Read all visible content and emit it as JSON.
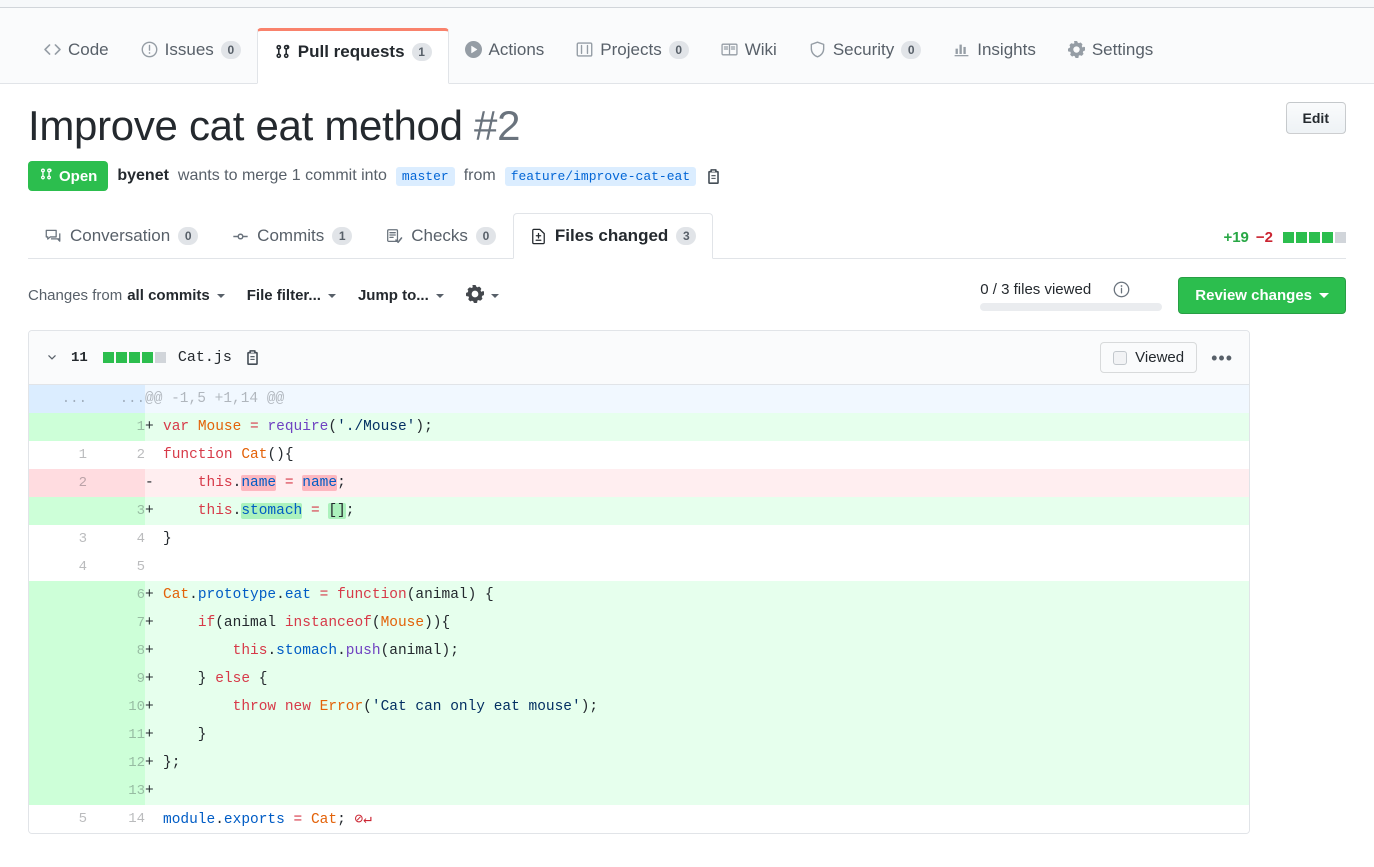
{
  "repo_nav": {
    "items": [
      {
        "label": "Code",
        "icon": "code-icon",
        "count": null,
        "selected": false
      },
      {
        "label": "Issues",
        "icon": "issue-icon",
        "count": "0",
        "selected": false
      },
      {
        "label": "Pull requests",
        "icon": "pull-request-icon",
        "count": "1",
        "selected": true
      },
      {
        "label": "Actions",
        "icon": "play-icon",
        "count": null,
        "selected": false
      },
      {
        "label": "Projects",
        "icon": "project-icon",
        "count": "0",
        "selected": false
      },
      {
        "label": "Wiki",
        "icon": "book-icon",
        "count": null,
        "selected": false
      },
      {
        "label": "Security",
        "icon": "shield-icon",
        "count": "0",
        "selected": false
      },
      {
        "label": "Insights",
        "icon": "graph-icon",
        "count": null,
        "selected": false
      },
      {
        "label": "Settings",
        "icon": "gear-icon",
        "count": null,
        "selected": false
      }
    ]
  },
  "pull_request": {
    "title": "Improve cat eat method",
    "number": "#2",
    "edit_label": "Edit",
    "state": "Open",
    "author": "byenet",
    "merge_text_1": "wants to merge 1 commit into",
    "base_branch": "master",
    "merge_text_2": "from",
    "head_branch": "feature/improve-cat-eat"
  },
  "pr_tabs": [
    {
      "label": "Conversation",
      "icon": "comment-discussion-icon",
      "count": "0",
      "selected": false
    },
    {
      "label": "Commits",
      "icon": "commit-icon",
      "count": "1",
      "selected": false
    },
    {
      "label": "Checks",
      "icon": "checklist-icon",
      "count": "0",
      "selected": false
    },
    {
      "label": "Files changed",
      "icon": "file-diff-icon",
      "count": "3",
      "selected": true
    }
  ],
  "diffstat": {
    "additions": "+19",
    "deletions": "−2",
    "blocks": [
      "g",
      "g",
      "g",
      "g",
      "n"
    ]
  },
  "toolbar": {
    "changes_from_prefix": "Changes from",
    "changes_from_value": "all commits",
    "file_filter_label": "File filter...",
    "jump_to_label": "Jump to...",
    "gear_icon": "gear-icon",
    "files_viewed": "0 / 3 files viewed",
    "info_icon": "info-icon",
    "review_changes_label": "Review changes"
  },
  "file": {
    "changes_count": "11",
    "blocks": [
      "g",
      "g",
      "g",
      "g",
      "n"
    ],
    "name": "Cat.js",
    "copy_icon": "copy-path-icon",
    "viewed_label": "Viewed",
    "kebab_icon": "kebab-horizontal-icon",
    "hunk_header": "@@ -1,5 +1,14 @@",
    "lines": [
      {
        "type": "hunk",
        "old": "...",
        "new": "...",
        "marker": "",
        "html": ""
      },
      {
        "type": "add",
        "old": "",
        "new": "1",
        "marker": "+",
        "html": "<span class=\"k\">var</span> <span class=\"e\">Mouse</span> <span class=\"k\">=</span> <span class=\"f\">require</span>(<span class=\"s\">'./Mouse'</span>);"
      },
      {
        "type": "ctx",
        "old": "1",
        "new": "2",
        "marker": "",
        "html": "<span class=\"k\">function</span> <span class=\"e\">Cat</span>(){"
      },
      {
        "type": "del",
        "old": "2",
        "new": "",
        "marker": "-",
        "html": "    <span class=\"k\">this</span>.<span class=\"wdel v\">name</span> <span class=\"k\">=</span> <span class=\"wdel v\">name</span>;"
      },
      {
        "type": "add",
        "old": "",
        "new": "3",
        "marker": "+",
        "html": "    <span class=\"k\">this</span>.<span class=\"wadd v\">stomach</span> <span class=\"k\">=</span> <span class=\"wadd p\">[]</span>;"
      },
      {
        "type": "ctx",
        "old": "3",
        "new": "4",
        "marker": "",
        "html": "}"
      },
      {
        "type": "ctx",
        "old": "4",
        "new": "5",
        "marker": "",
        "html": ""
      },
      {
        "type": "add",
        "old": "",
        "new": "6",
        "marker": "+",
        "html": "<span class=\"e\">Cat</span>.<span class=\"v\">prototype</span>.<span class=\"v\">eat</span> <span class=\"k\">=</span> <span class=\"k\">function</span>(animal) {"
      },
      {
        "type": "add",
        "old": "",
        "new": "7",
        "marker": "+",
        "html": "    <span class=\"k\">if</span>(animal <span class=\"k\">instanceof</span>(<span class=\"e\">Mouse</span>)){"
      },
      {
        "type": "add",
        "old": "",
        "new": "8",
        "marker": "+",
        "html": "        <span class=\"k\">this</span>.<span class=\"v\">stomach</span>.<span class=\"f\">push</span>(animal);"
      },
      {
        "type": "add",
        "old": "",
        "new": "9",
        "marker": "+",
        "html": "    } <span class=\"k\">else</span> {"
      },
      {
        "type": "add",
        "old": "",
        "new": "10",
        "marker": "+",
        "html": "        <span class=\"k\">throw</span> <span class=\"k\">new</span> <span class=\"e\">Error</span>(<span class=\"s\">'Cat can only eat mouse'</span>);"
      },
      {
        "type": "add",
        "old": "",
        "new": "11",
        "marker": "+",
        "html": "    }"
      },
      {
        "type": "add",
        "old": "",
        "new": "12",
        "marker": "+",
        "html": "};"
      },
      {
        "type": "add",
        "old": "",
        "new": "13",
        "marker": "+",
        "html": ""
      },
      {
        "type": "ctx",
        "old": "5",
        "new": "14",
        "marker": "",
        "html": "<span class=\"v\">module</span>.<span class=\"v\">exports</span> <span class=\"k\">=</span> <span class=\"e\">Cat</span>; <span class=\"nonewline\">⊘↵</span>"
      }
    ]
  },
  "colors": {
    "accent_orange": "#f9826c",
    "open_green": "#2cbe4e",
    "addition_bg": "#e6ffed",
    "deletion_bg": "#ffeef0",
    "hunk_bg": "#f1f8ff",
    "link_blue": "#0366d6"
  }
}
